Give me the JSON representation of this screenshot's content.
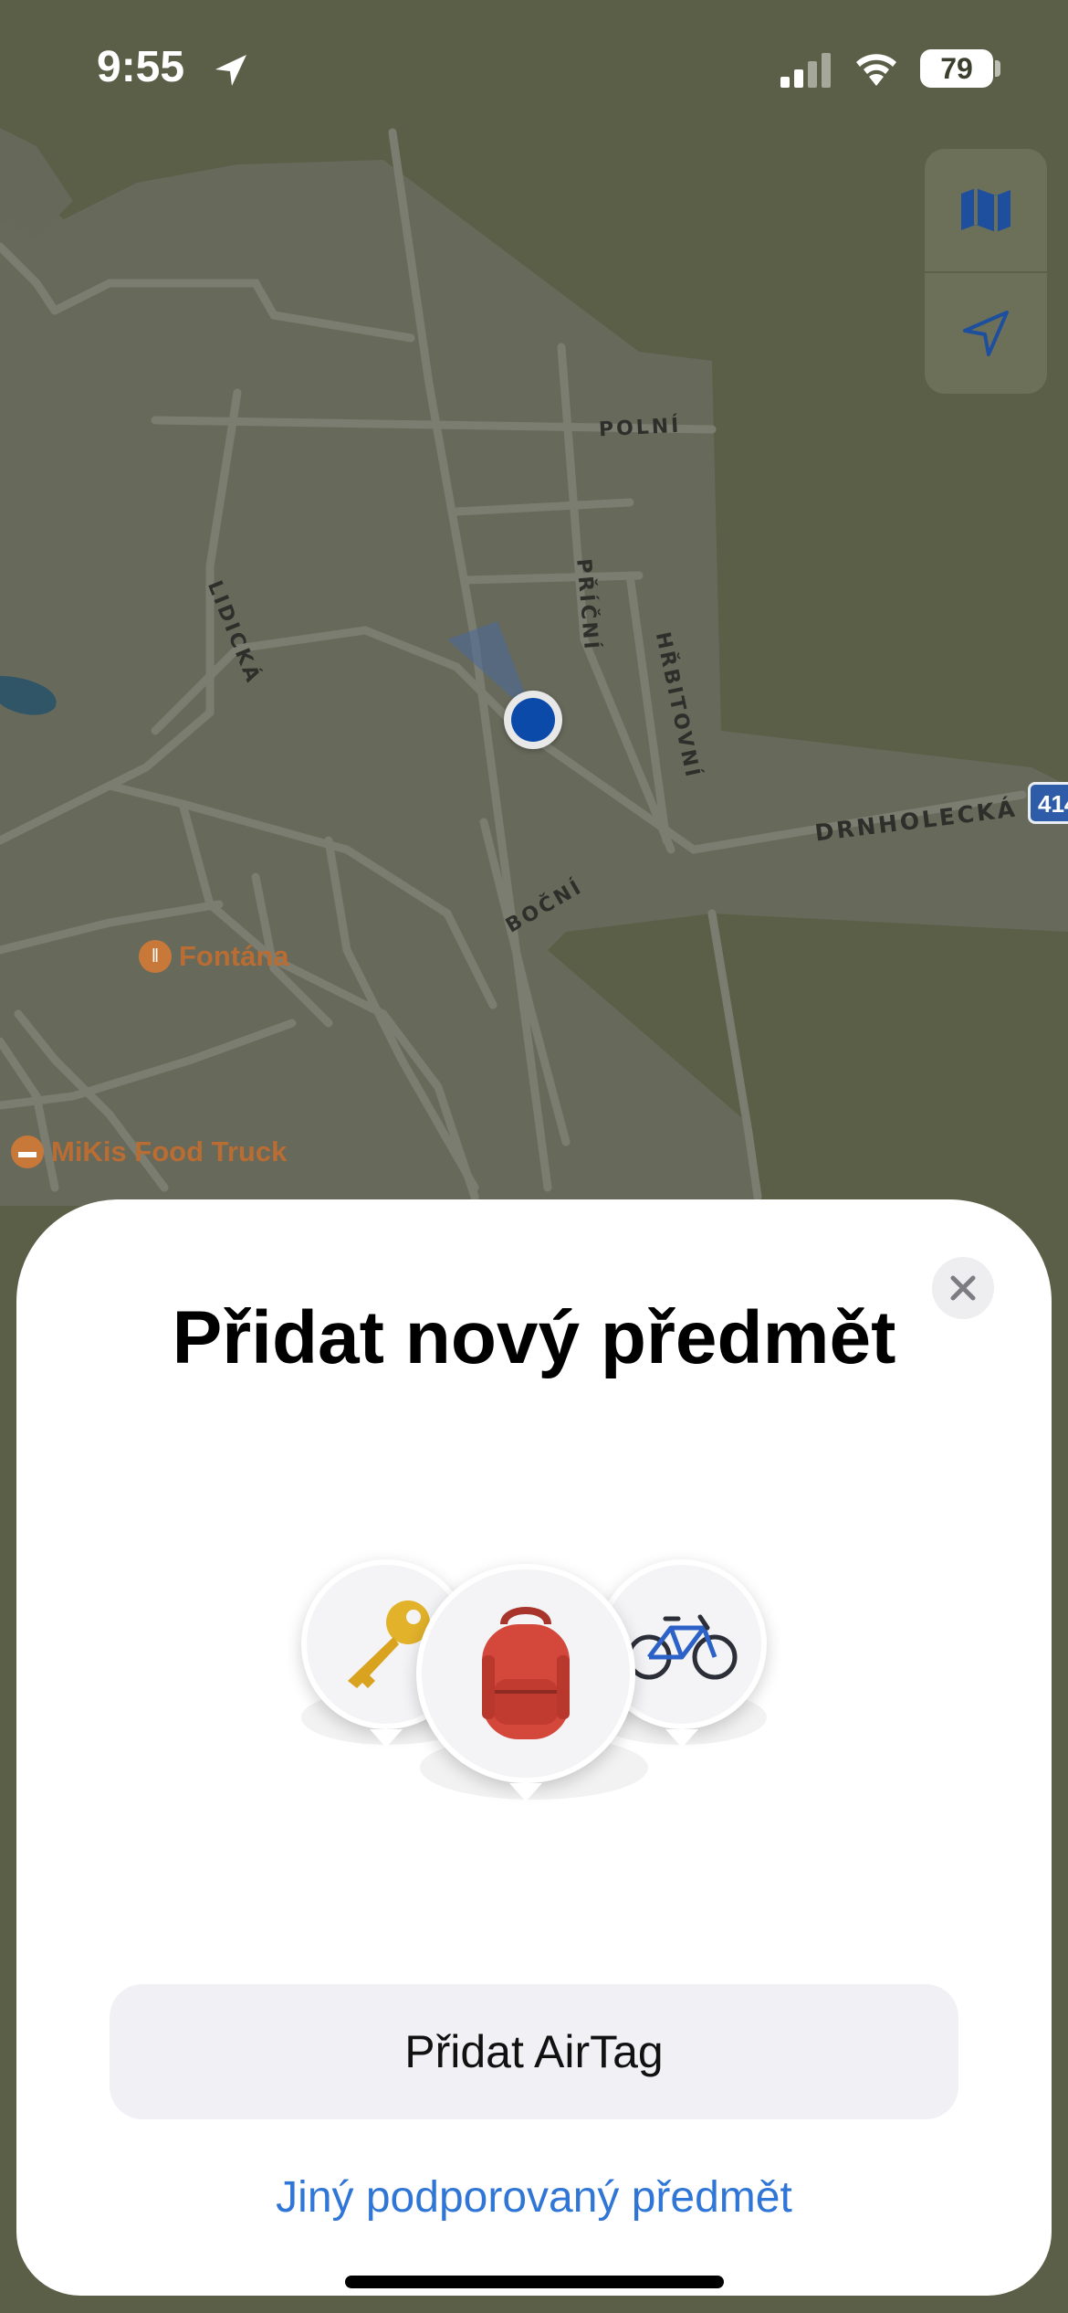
{
  "status_bar": {
    "time": "9:55",
    "battery": "79"
  },
  "map": {
    "streets": [
      "POLNÍ",
      "LIDICKÁ",
      "PŘÍČNÍ",
      "HŘBITOVNÍ",
      "DRNHOLECKÁ",
      "BOČNÍ"
    ],
    "road_number": "414",
    "pois": [
      {
        "name": "Fontána",
        "icon": "fork-knife-icon"
      },
      {
        "name": "MiKis Food Truck",
        "icon": "food-truck-icon"
      }
    ],
    "controls": [
      "map-icon",
      "location-arrow-icon"
    ]
  },
  "sheet": {
    "title": "Přidat nový předmět",
    "illustration_items": [
      "key",
      "backpack",
      "bicycle"
    ],
    "primary_button": "Přidat AirTag",
    "secondary_link": "Jiný podporovaný předmět"
  },
  "colors": {
    "map_land": "#5b5f47",
    "map_urban": "#6a6c5e",
    "accent_blue": "#2f76d6",
    "location_dot": "#0b4aa8"
  }
}
